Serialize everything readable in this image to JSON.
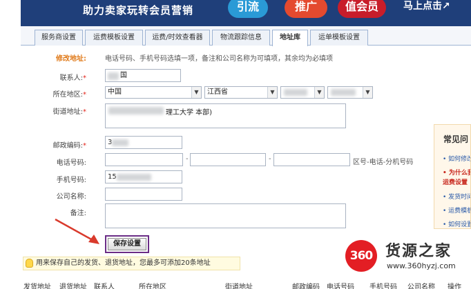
{
  "banner": {
    "slogan": "助力卖家玩转会员营销",
    "pills": [
      "引流",
      "推广",
      "值会员"
    ],
    "cta": "马上点击↗"
  },
  "tabs": [
    "服务商设置",
    "运费模板设置",
    "运费/时效查看器",
    "物流跟踪信息",
    "地址库",
    "运单模板设置"
  ],
  "active_tab": "地址库",
  "form": {
    "section_title": "修改地址:",
    "section_note": "电话号码、手机号码选填一项，备注和公司名称为可填项，其余均为必填项",
    "contact": {
      "label": "联系人:",
      "value": "国"
    },
    "region": {
      "label": "所在地区:",
      "country": "中国",
      "province": "江西省"
    },
    "street": {
      "label": "街道地址:",
      "value": "理工大学  本部)"
    },
    "zip": {
      "label": "邮政编码:",
      "value": "3"
    },
    "phone": {
      "label": "电话号码:",
      "hint": "区号-电话-分机号码"
    },
    "mobile": {
      "label": "手机号码:",
      "value": "15"
    },
    "company": {
      "label": "公司名称:"
    },
    "remark": {
      "label": "备注:"
    },
    "required_mark": "*",
    "save_button": "保存设置",
    "separator": "-"
  },
  "tip": "用来保存自己的发货、退货地址，您最多可添加20条地址",
  "table_headers": [
    "发货地址",
    "退货地址",
    "联系人",
    "所在地区",
    "街道地址",
    "邮政编码",
    "电话号码",
    "手机号码",
    "公司名称",
    "操作"
  ],
  "faq": {
    "title": "常见问",
    "items": [
      "如何修改",
      "为什么我",
      "运费设置",
      "发货时间",
      "运费模板",
      "如何设置"
    ]
  },
  "watermark": {
    "logo": "360",
    "name": "货源之家",
    "url": "www.360hyzj.com"
  },
  "colors": {
    "banner": "#1f3f7a",
    "accent_orange": "#e07a1a",
    "required_red": "#e3231a",
    "highlight_purple": "#6a2c86",
    "arrow_red": "#d93a2c"
  }
}
